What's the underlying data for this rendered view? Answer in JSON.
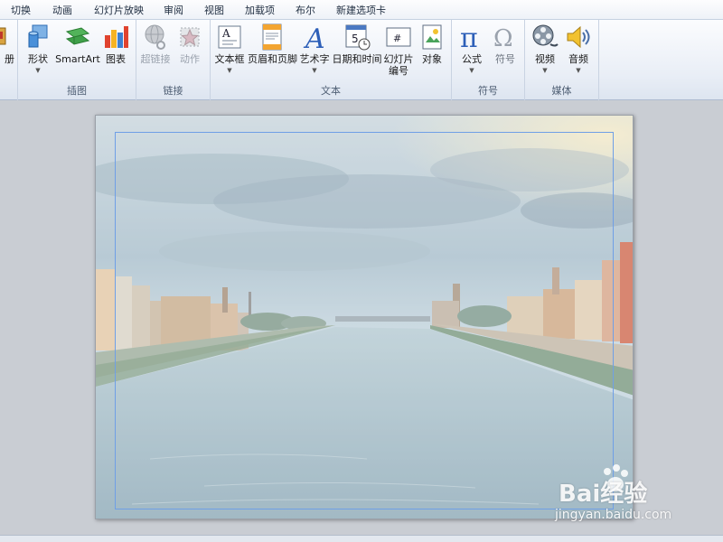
{
  "tabs": [
    "切换",
    "动画",
    "幻灯片放映",
    "审阅",
    "视图",
    "加载项",
    "布尔",
    "新建选项卡"
  ],
  "ribbon": {
    "partial_left_label": "册",
    "illustrations": {
      "label": "插图",
      "shapes": "形状",
      "smartart": "SmartArt",
      "chart": "图表"
    },
    "links": {
      "label": "链接",
      "hyperlink": "超链接",
      "action": "动作"
    },
    "text": {
      "label": "文本",
      "textbox": "文本框",
      "header_footer": "页眉和页脚",
      "wordart": "艺术字",
      "datetime": "日期和时间",
      "slide_number_line1": "幻灯片",
      "slide_number_line2": "编号",
      "object": "对象"
    },
    "symbols": {
      "label": "符号",
      "equation": "公式",
      "symbol": "符号"
    },
    "media": {
      "label": "媒体",
      "video": "视频",
      "audio": "音频"
    }
  },
  "watermark": {
    "brand": "Bai经验",
    "url": "jingyan.baidu.com"
  },
  "colors": {
    "accent": "#1f5fbf",
    "placeholder_border": "#6f9fe6"
  }
}
